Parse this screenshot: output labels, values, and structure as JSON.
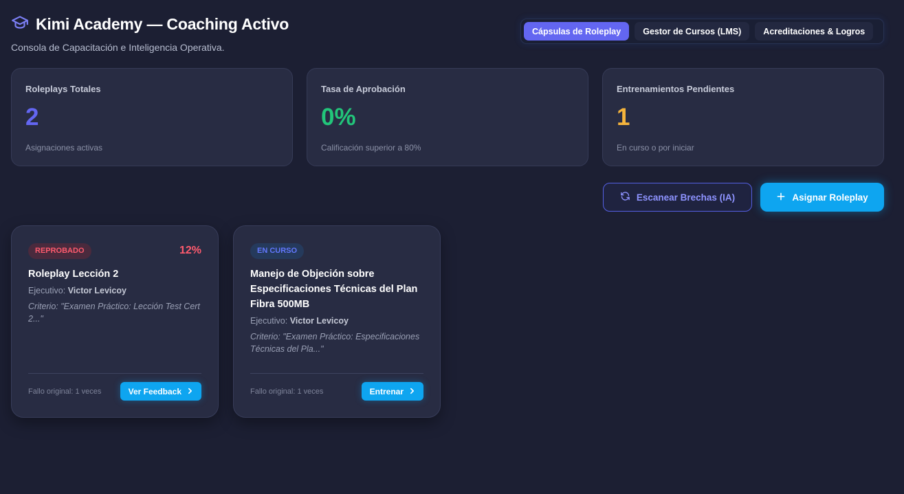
{
  "header": {
    "title": "Kimi Academy — Coaching Activo",
    "subtitle": "Consola de Capacitación e Inteligencia Operativa.",
    "icon": "graduation-cap-icon"
  },
  "tabs": [
    {
      "label": "Cápsulas de Roleplay",
      "active": true
    },
    {
      "label": "Gestor de Cursos (LMS)",
      "active": false
    },
    {
      "label": "Acreditaciones & Logros",
      "active": false
    }
  ],
  "stats": [
    {
      "label": "Roleplays Totales",
      "value": "2",
      "desc": "Asignaciones activas",
      "color": "#6366f1"
    },
    {
      "label": "Tasa de Aprobación",
      "value": "0%",
      "desc": "Calificación superior a 80%",
      "color": "#22c57a"
    },
    {
      "label": "Entrenamientos Pendientes",
      "value": "1",
      "desc": "En curso o por iniciar",
      "color": "#f5b43c"
    }
  ],
  "actions": {
    "scan_label": "Escanear Brechas (IA)",
    "assign_label": "Asignar Roleplay"
  },
  "cards": [
    {
      "badge": "REPROBADO",
      "score": "12%",
      "title": "Roleplay Lección 2",
      "exec_label": "Ejecutivo:",
      "exec_name": "Victor Levicoy",
      "criteria": "Criterio: \"Examen Práctico: Lección Test Cert 2...\"",
      "fail_count": "Fallo original: 1 veces",
      "button": "Ver Feedback"
    },
    {
      "badge": "EN CURSO",
      "title": "Manejo de Objeción sobre Especificaciones Técnicas del Plan Fibra 500MB",
      "exec_label": "Ejecutivo:",
      "exec_name": "Victor Levicoy",
      "criteria": "Criterio: \"Examen Práctico: Especificaciones Técnicas del Pla...\"",
      "fail_count": "Fallo original: 1 veces",
      "button": "Entrenar"
    }
  ],
  "colors": {
    "background": "#1c1f33",
    "accent": "#6366f1",
    "primary": "#0ea5f0",
    "danger": "#ff5b6e"
  }
}
